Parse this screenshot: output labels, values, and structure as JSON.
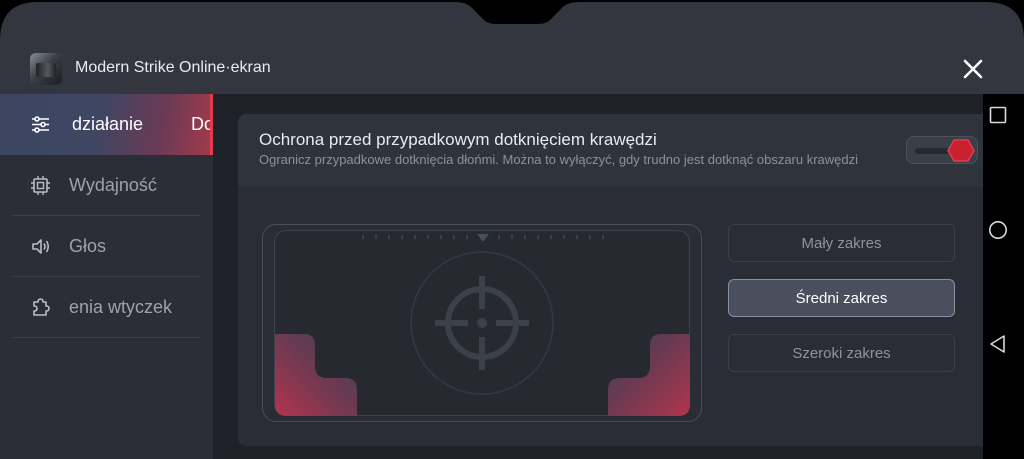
{
  "header": {
    "app_title": "Modern Strike Online·ekran"
  },
  "sidebar": {
    "items": [
      {
        "label": "działanie",
        "icon": "sliders-icon",
        "active": true,
        "clipped_next": "Do"
      },
      {
        "label": "Wydajność",
        "icon": "chip-icon",
        "active": false
      },
      {
        "label": "Głos",
        "icon": "speaker-icon",
        "active": false
      },
      {
        "label": "enia wtyczek",
        "icon": "puzzle-icon",
        "active": false
      }
    ]
  },
  "setting": {
    "title": "Ochrona przed przypadkowym dotknięciem krawędzi",
    "description": "Ogranicz przypadkowe dotknięcia dłońmi. Można to wyłączyć, gdy trudno jest dotknąć obszaru krawędzi",
    "enabled": true
  },
  "range_options": [
    {
      "label": "Mały zakres",
      "selected": false
    },
    {
      "label": "Średni zakres",
      "selected": true
    },
    {
      "label": "Szeroki zakres",
      "selected": false
    }
  ],
  "colors": {
    "accent_red": "#e23b4e",
    "panel_bg": "#1f2128",
    "sidebar_bg": "#2b2e36",
    "card_bg": "#2a2d35"
  }
}
